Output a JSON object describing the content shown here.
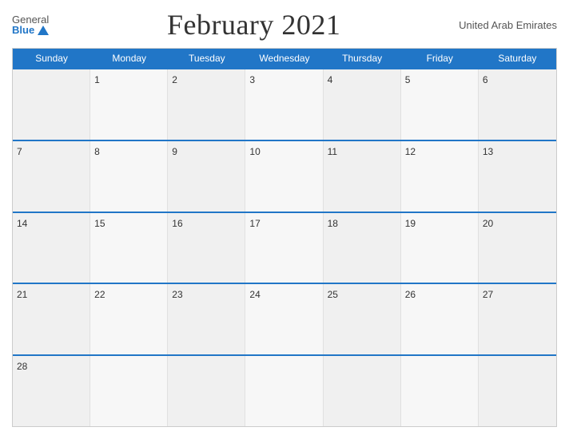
{
  "header": {
    "logo": {
      "general": "General",
      "blue": "Blue"
    },
    "title": "February 2021",
    "country": "United Arab Emirates"
  },
  "days_of_week": [
    "Sunday",
    "Monday",
    "Tuesday",
    "Wednesday",
    "Thursday",
    "Friday",
    "Saturday"
  ],
  "weeks": [
    [
      {
        "day": "",
        "empty": true
      },
      {
        "day": "1"
      },
      {
        "day": "2"
      },
      {
        "day": "3"
      },
      {
        "day": "4"
      },
      {
        "day": "5"
      },
      {
        "day": "6"
      }
    ],
    [
      {
        "day": "7"
      },
      {
        "day": "8"
      },
      {
        "day": "9"
      },
      {
        "day": "10"
      },
      {
        "day": "11"
      },
      {
        "day": "12"
      },
      {
        "day": "13"
      }
    ],
    [
      {
        "day": "14"
      },
      {
        "day": "15"
      },
      {
        "day": "16"
      },
      {
        "day": "17"
      },
      {
        "day": "18"
      },
      {
        "day": "19"
      },
      {
        "day": "20"
      }
    ],
    [
      {
        "day": "21"
      },
      {
        "day": "22"
      },
      {
        "day": "23"
      },
      {
        "day": "24"
      },
      {
        "day": "25"
      },
      {
        "day": "26"
      },
      {
        "day": "27"
      }
    ],
    [
      {
        "day": "28"
      },
      {
        "day": "",
        "empty": true
      },
      {
        "day": "",
        "empty": true
      },
      {
        "day": "",
        "empty": true
      },
      {
        "day": "",
        "empty": true
      },
      {
        "day": "",
        "empty": true
      },
      {
        "day": "",
        "empty": true
      }
    ]
  ]
}
